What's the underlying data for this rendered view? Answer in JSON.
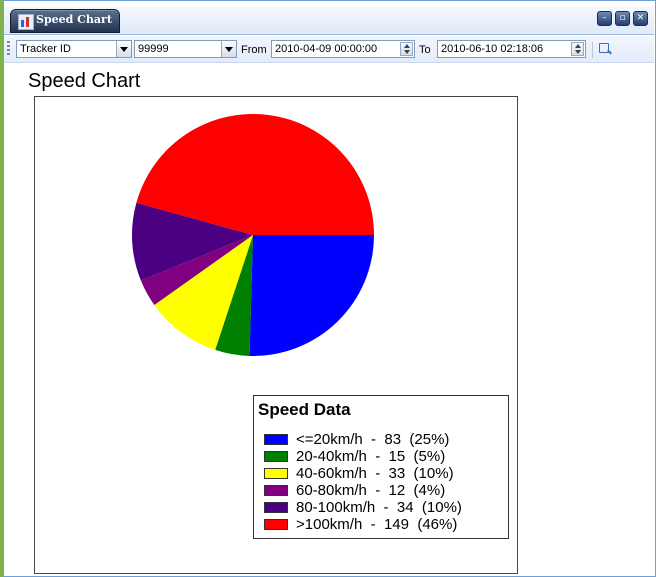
{
  "window": {
    "title": "Speed Chart",
    "buttons": [
      "minimize",
      "restore",
      "close"
    ]
  },
  "toolbar": {
    "filter_field": "Tracker ID",
    "filter_value": "99999",
    "from_label": "From",
    "from_value": "2010-04-09 00:00:00",
    "to_label": "To",
    "to_value": "2010-06-10 02:18:06"
  },
  "page": {
    "title": "Speed Chart"
  },
  "chart_data": {
    "type": "pie",
    "legend_title": "Speed Data",
    "legend_placement": "bottom-right",
    "slices": [
      {
        "label": "<=20km/h",
        "value": 83,
        "percent": "25%",
        "color": "#0000ff"
      },
      {
        "label": "20-40km/h",
        "value": 15,
        "percent": "5%",
        "color": "#007f00"
      },
      {
        "label": "40-60km/h",
        "value": 33,
        "percent": "10%",
        "color": "#ffff00"
      },
      {
        "label": "60-80km/h",
        "value": 12,
        "percent": "4%",
        "color": "#800080"
      },
      {
        "label": "80-100km/h",
        "value": 34,
        "percent": "10%",
        "color": "#4b0082"
      },
      {
        "label": ">100km/h",
        "value": 149,
        "percent": "46%",
        "color": "#ff0000"
      }
    ]
  }
}
